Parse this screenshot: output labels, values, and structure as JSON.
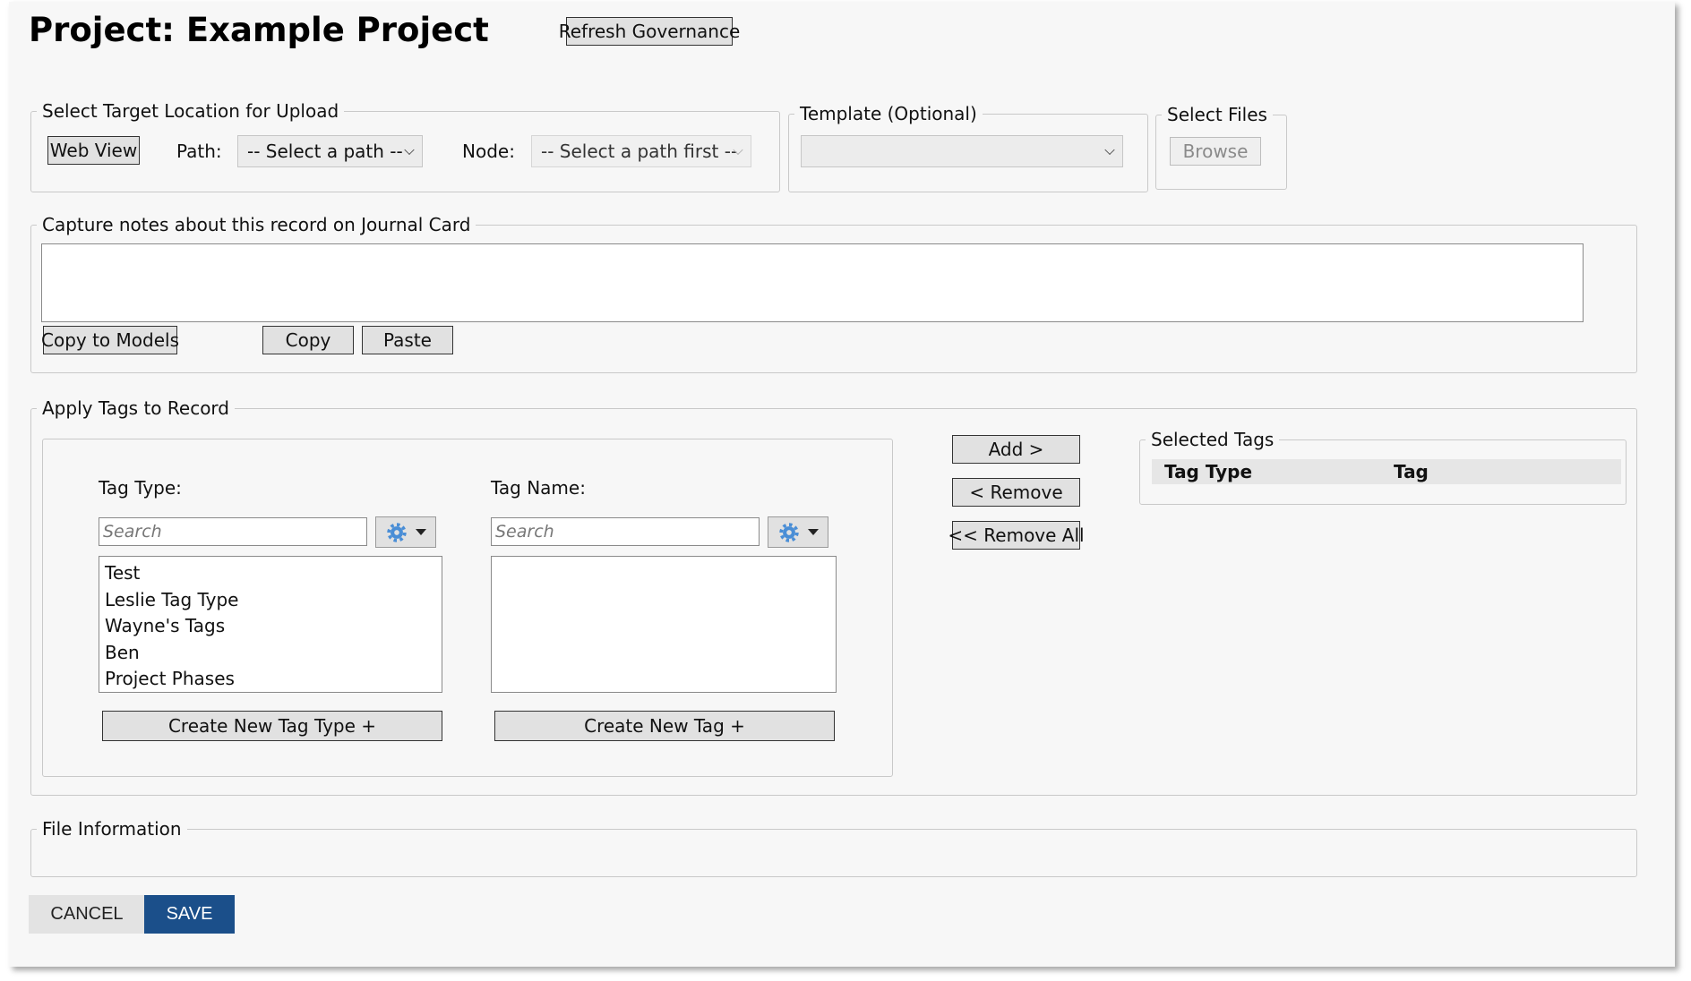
{
  "header": {
    "title": "Project: Example Project",
    "refresh_label": "Refresh Governance"
  },
  "target_location": {
    "legend": "Select Target Location for Upload",
    "web_view_label": "Web View",
    "path_label": "Path:",
    "path_value": "-- Select a path --",
    "node_label": "Node:",
    "node_value": "-- Select a path first --"
  },
  "template": {
    "legend": "Template (Optional)",
    "value": ""
  },
  "select_files": {
    "legend": "Select Files",
    "browse_label": "Browse"
  },
  "notes": {
    "legend": "Capture notes about this record on Journal Card",
    "value": "",
    "copy_to_models_label": "Copy to Models",
    "copy_label": "Copy",
    "paste_label": "Paste"
  },
  "tags": {
    "legend": "Apply Tags to Record",
    "tag_type_label": "Tag Type:",
    "tag_type_search_placeholder": "Search",
    "tag_type_items": [
      "Test",
      "Leslie Tag Type",
      "Wayne's Tags",
      "Ben",
      "Project Phases"
    ],
    "create_tag_type_label": "Create New Tag Type +",
    "tag_name_label": "Tag Name:",
    "tag_name_search_placeholder": "Search",
    "create_tag_label": "Create New Tag +",
    "add_label": "Add >",
    "remove_label": "< Remove",
    "remove_all_label": "<< Remove All",
    "selected_legend": "Selected Tags",
    "selected_columns": [
      "Tag Type",
      "Tag"
    ]
  },
  "file_info": {
    "legend": "File Information"
  },
  "footer": {
    "cancel_label": "CANCEL",
    "save_label": "SAVE"
  },
  "colors": {
    "save_button": "#1b4f8a",
    "window_background": "#f7f7f7",
    "gear_icon": "#4a8ed6"
  },
  "icons": {
    "gear": "gear-icon",
    "dropdown": "chevron-down-icon",
    "menu_caret": "caret-down-icon"
  }
}
